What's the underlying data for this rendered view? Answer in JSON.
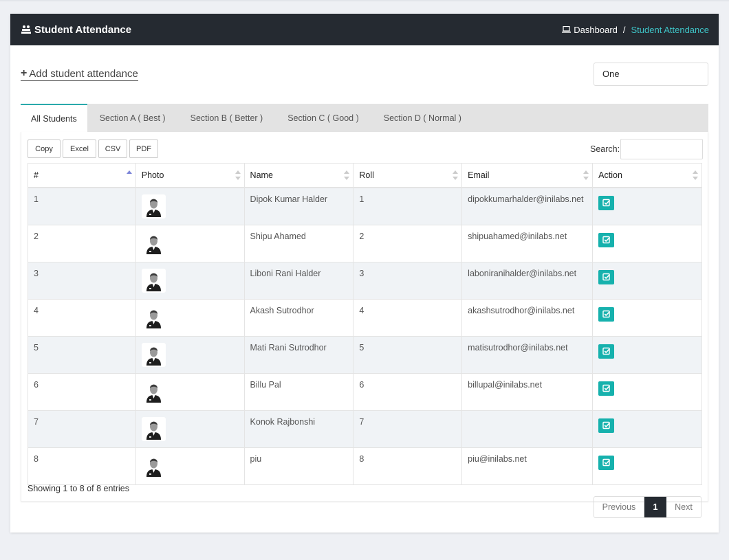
{
  "header": {
    "title": "Student Attendance",
    "breadcrumb": {
      "home": "Dashboard",
      "separator": "/",
      "current": "Student Attendance"
    }
  },
  "toolbar": {
    "add_label": "Add student attendance",
    "class_select_value": "One"
  },
  "tabs": [
    {
      "label": "All Students",
      "active": true
    },
    {
      "label": "Section A ( Best )"
    },
    {
      "label": "Section B ( Better )"
    },
    {
      "label": "Section C ( Good )"
    },
    {
      "label": "Section D ( Normal )"
    }
  ],
  "export_buttons": [
    "Copy",
    "Excel",
    "CSV",
    "PDF"
  ],
  "search": {
    "label": "Search:",
    "value": ""
  },
  "table": {
    "columns": [
      "#",
      "Photo",
      "Name",
      "Roll",
      "Email",
      "Action"
    ],
    "rows": [
      {
        "num": "1",
        "name": "Dipok Kumar Halder",
        "roll": "1",
        "email": "dipokkumarhalder@inilabs.net"
      },
      {
        "num": "2",
        "name": "Shipu Ahamed",
        "roll": "2",
        "email": "shipuahamed@inilabs.net"
      },
      {
        "num": "3",
        "name": "Liboni Rani Halder",
        "roll": "3",
        "email": "laboniranihalder@inilabs.net"
      },
      {
        "num": "4",
        "name": "Akash Sutrodhor",
        "roll": "4",
        "email": "akashsutrodhor@inilabs.net"
      },
      {
        "num": "5",
        "name": "Mati Rani Sutrodhor",
        "roll": "5",
        "email": "matisutrodhor@inilabs.net"
      },
      {
        "num": "6",
        "name": "Billu Pal",
        "roll": "6",
        "email": "billupal@inilabs.net"
      },
      {
        "num": "7",
        "name": "Konok Rajbonshi",
        "roll": "7",
        "email": ""
      },
      {
        "num": "8",
        "name": "piu",
        "roll": "8",
        "email": "piu@inilabs.net"
      }
    ]
  },
  "footer": {
    "info": "Showing 1 to 8 of 8 entries",
    "pagination": {
      "previous": "Previous",
      "current": "1",
      "next": "Next"
    }
  },
  "colors": {
    "header_bg": "#252a31",
    "accent": "#3ec3c6",
    "action_button": "#16b1ad"
  }
}
